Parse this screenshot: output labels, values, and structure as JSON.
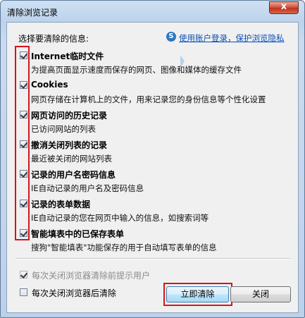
{
  "window": {
    "title": "清除浏览记录",
    "close_glyph": "x"
  },
  "section_label": "选择要清除的信息:",
  "link": {
    "icon": "S",
    "text": "使用账户登录，保护浏览隐私"
  },
  "items": [
    {
      "title": "Internet临时文件",
      "desc": "为提高页面显示速度而保存的网页、图像和媒体的缓存文件",
      "checked": true
    },
    {
      "title": "Cookies",
      "desc": "网页存储在计算机上的文件，用来记录您的身份信息等个性化设置",
      "checked": true
    },
    {
      "title": "网页访问的历史记录",
      "desc": "已访问网站的列表",
      "checked": true
    },
    {
      "title": "撤消关闭列表的记录",
      "desc": "最近被关闭的网站列表",
      "checked": true
    },
    {
      "title": "记录的用户名密码信息",
      "desc": "IE自动记录的用户名及密码信息",
      "checked": true
    },
    {
      "title": "记录的表单数据",
      "desc": "IE自动记录的您在网页中输入的信息，如搜索词等",
      "checked": true
    },
    {
      "title": "智能填表中的已保存表单",
      "desc": "搜狗\"智能填表\"功能保存的用于自动填写表单的信息",
      "checked": true
    }
  ],
  "options": {
    "prompt_on_close": {
      "label": "每次关闭浏览器清除前提示用户",
      "checked": true,
      "disabled": true
    },
    "clear_on_close": {
      "label": "每次关闭浏览器后清除",
      "checked": false
    }
  },
  "buttons": {
    "clear_now": "立即清除",
    "close": "关闭"
  },
  "colors": {
    "highlight_red": "#d8141b",
    "link_blue": "#0a4fb8"
  }
}
